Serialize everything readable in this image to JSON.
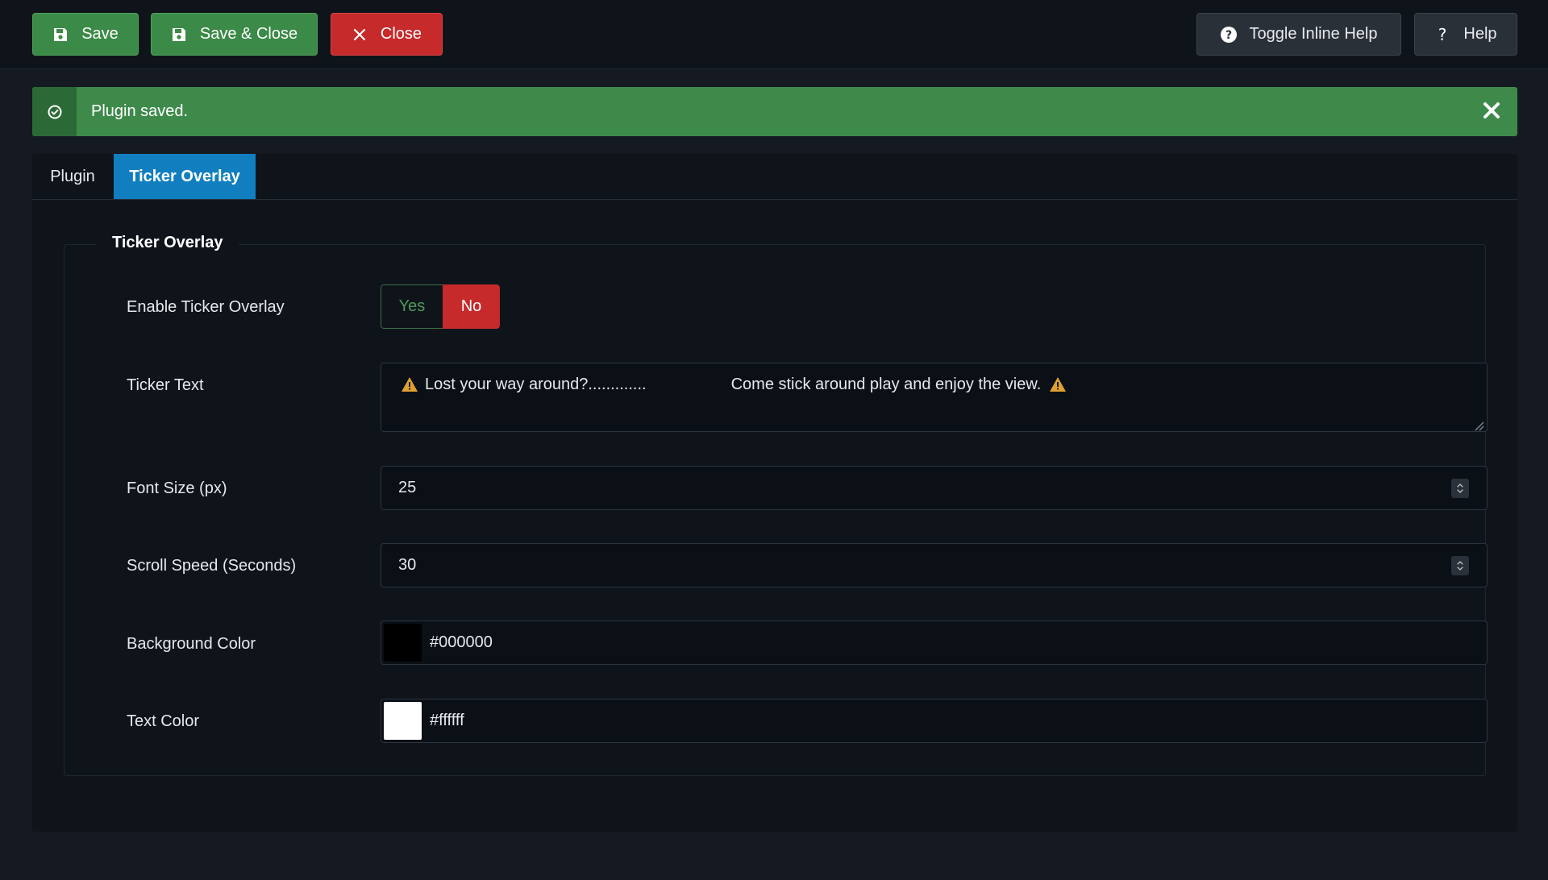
{
  "toolbar": {
    "save_label": "Save",
    "save_close_label": "Save & Close",
    "close_label": "Close",
    "toggle_help_label": "Toggle Inline Help",
    "help_label": "Help"
  },
  "alert": {
    "message": "Plugin saved."
  },
  "tabs": [
    {
      "label": "Plugin",
      "active": false
    },
    {
      "label": "Ticker Overlay",
      "active": true
    }
  ],
  "fieldset": {
    "legend": "Ticker Overlay",
    "enable": {
      "label": "Enable Ticker Overlay",
      "yes_label": "Yes",
      "no_label": "No",
      "selected": "No"
    },
    "ticker_text": {
      "label": "Ticker Text",
      "part1": "Lost your way around?.............",
      "part2": "Come stick around play and enjoy the view."
    },
    "font_size": {
      "label": "Font Size (px)",
      "value": "25"
    },
    "scroll_speed": {
      "label": "Scroll Speed (Seconds)",
      "value": "30"
    },
    "background_color": {
      "label": "Background Color",
      "value": "#000000"
    },
    "text_color": {
      "label": "Text Color",
      "value": "#ffffff"
    }
  },
  "colors": {
    "success": "#3e8a4b",
    "danger": "#c62a2a",
    "active_tab": "#117fbf",
    "warning_icon": "#e0a030"
  },
  "icons": {
    "save": "floppy-disk-icon",
    "close": "x-icon",
    "toggle_help": "question-circle-icon",
    "help": "question-icon",
    "alert": "check-circle-icon",
    "alert_close": "close-icon",
    "warning": "warning-triangle-icon"
  }
}
